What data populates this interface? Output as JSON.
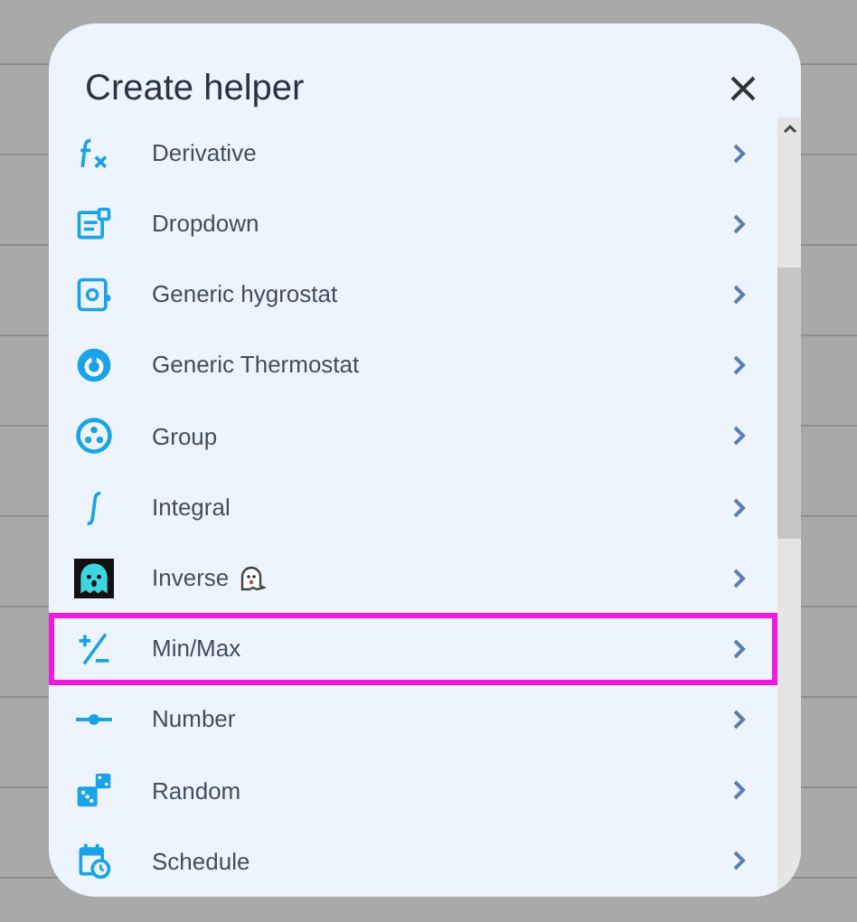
{
  "dialog": {
    "title": "Create helper",
    "items": [
      {
        "kind": "derivative",
        "label": "Derivative",
        "highlighted": false
      },
      {
        "kind": "dropdown",
        "label": "Dropdown",
        "highlighted": false
      },
      {
        "kind": "hygrostat",
        "label": "Generic hygrostat",
        "highlighted": false
      },
      {
        "kind": "thermostat",
        "label": "Generic Thermostat",
        "highlighted": false
      },
      {
        "kind": "group",
        "label": "Group",
        "highlighted": false
      },
      {
        "kind": "integral",
        "label": "Integral",
        "highlighted": false
      },
      {
        "kind": "inverse",
        "label": "Inverse",
        "highlighted": false
      },
      {
        "kind": "minmax",
        "label": "Min/Max",
        "highlighted": true
      },
      {
        "kind": "number",
        "label": "Number",
        "highlighted": false
      },
      {
        "kind": "random",
        "label": "Random",
        "highlighted": false
      },
      {
        "kind": "schedule",
        "label": "Schedule",
        "highlighted": false
      }
    ]
  }
}
